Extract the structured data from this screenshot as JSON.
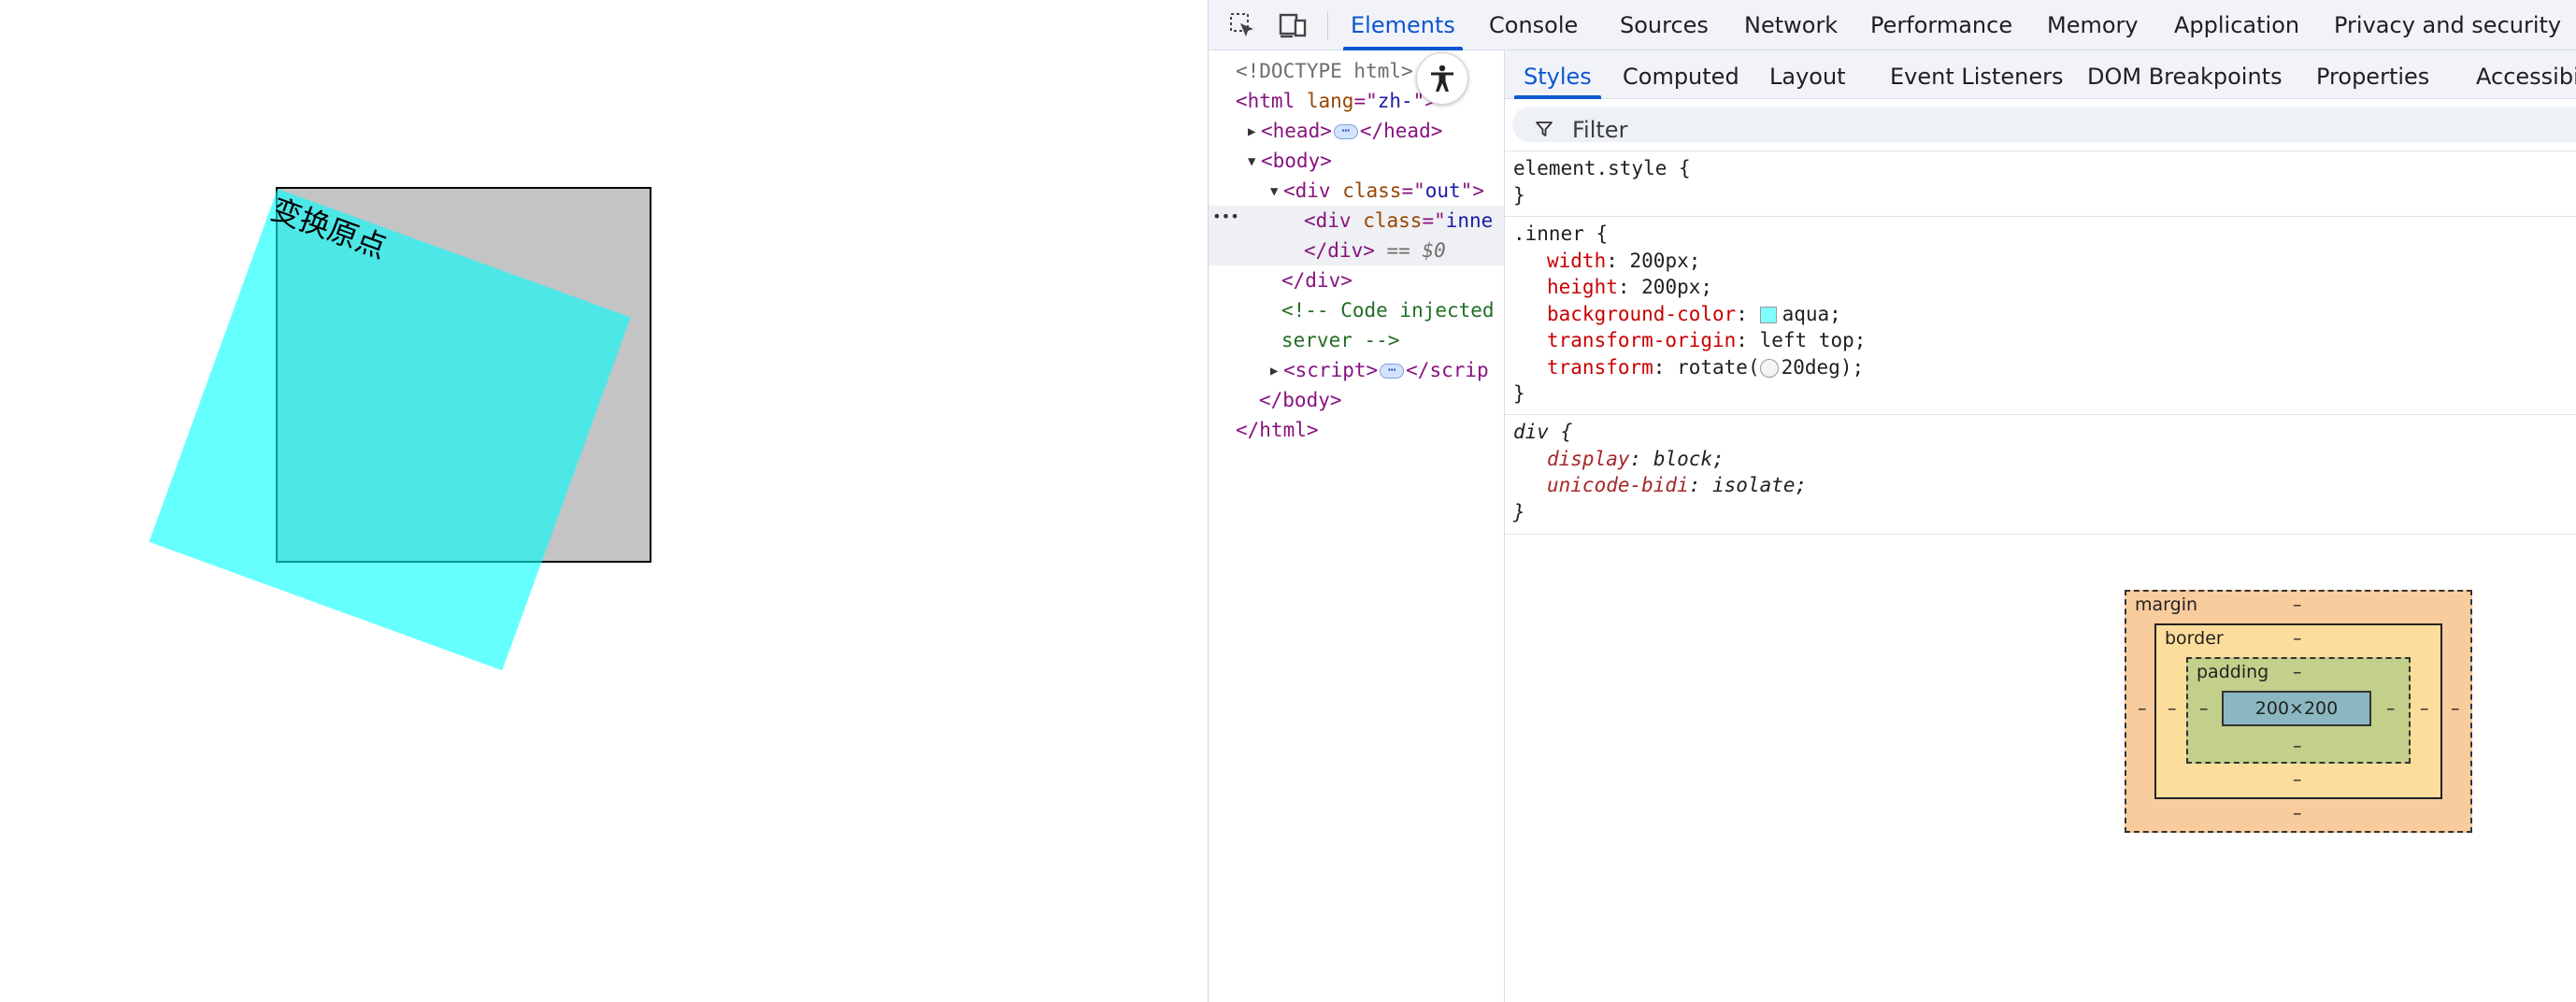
{
  "page": {
    "inner_text": "变换原点",
    "outer_color": "#c4c4c4",
    "inner_color": "#00ffff",
    "inner_opacity": 0.6
  },
  "devtools": {
    "main_tabs": [
      "Elements",
      "Console",
      "Sources",
      "Network",
      "Performance",
      "Memory",
      "Application",
      "Privacy and security"
    ],
    "active_main_tab": "Elements",
    "accent": "#0b57d0",
    "dom": {
      "doctype": "<!DOCTYPE html>",
      "html_open_a": "<html ",
      "html_attr": "lang",
      "html_eq": "=\"",
      "html_val": "zh-",
      "html_rest": "\">",
      "head_open": "<head>",
      "head_close": "</head>",
      "body_open": "<body>",
      "div_out_a": "<div ",
      "div_out_attr": "class",
      "div_out_eq": "=\"",
      "div_out_val": "out",
      "div_out_end": "\">",
      "div_inner_a": "<div ",
      "div_inner_attr": "class",
      "div_inner_eq": "=\"",
      "div_inner_val": "inne",
      "div_close_sel": "</div>",
      "eq0": "== $0",
      "div_close": "</div>",
      "comment_1": "<!-- Code injected",
      "comment_2": "server -->",
      "script_open": "<script>",
      "script_close": "</scrip",
      "body_close": "</body>",
      "html_close": "</html>",
      "ellipsis": "⋯",
      "row_marker": "•••"
    },
    "sub_tabs": [
      "Styles",
      "Computed",
      "Layout",
      "Event Listeners",
      "DOM Breakpoints",
      "Properties",
      "Accessibi"
    ],
    "active_sub_tab": "Styles",
    "filter_placeholder": "Filter",
    "styles": {
      "element_style": "element.style {",
      "close_brace": "}",
      "inner_selector": ".inner {",
      "props": [
        {
          "name": "width",
          "value": "200px;"
        },
        {
          "name": "height",
          "value": "200px;"
        },
        {
          "name": "background-color",
          "value": "aqua;"
        },
        {
          "name": "transform-origin",
          "value": "left top;"
        },
        {
          "name": "transform",
          "value_pre": "rotate(",
          "value_post": "20deg);"
        }
      ],
      "swatch_color": "#7fffff",
      "ua_selector": "div {",
      "ua_props": [
        {
          "name": "display",
          "value": "block;"
        },
        {
          "name": "unicode-bidi",
          "value": "isolate;"
        }
      ],
      "colon": ": "
    },
    "box_model": {
      "margin_label": "margin",
      "border_label": "border",
      "padding_label": "padding",
      "content": "200×200",
      "dash": "–",
      "margin_color": "#f9cc9d",
      "border_color": "#fddd9b",
      "padding_color": "#c3d08b",
      "content_color": "#8cb6c0"
    }
  }
}
